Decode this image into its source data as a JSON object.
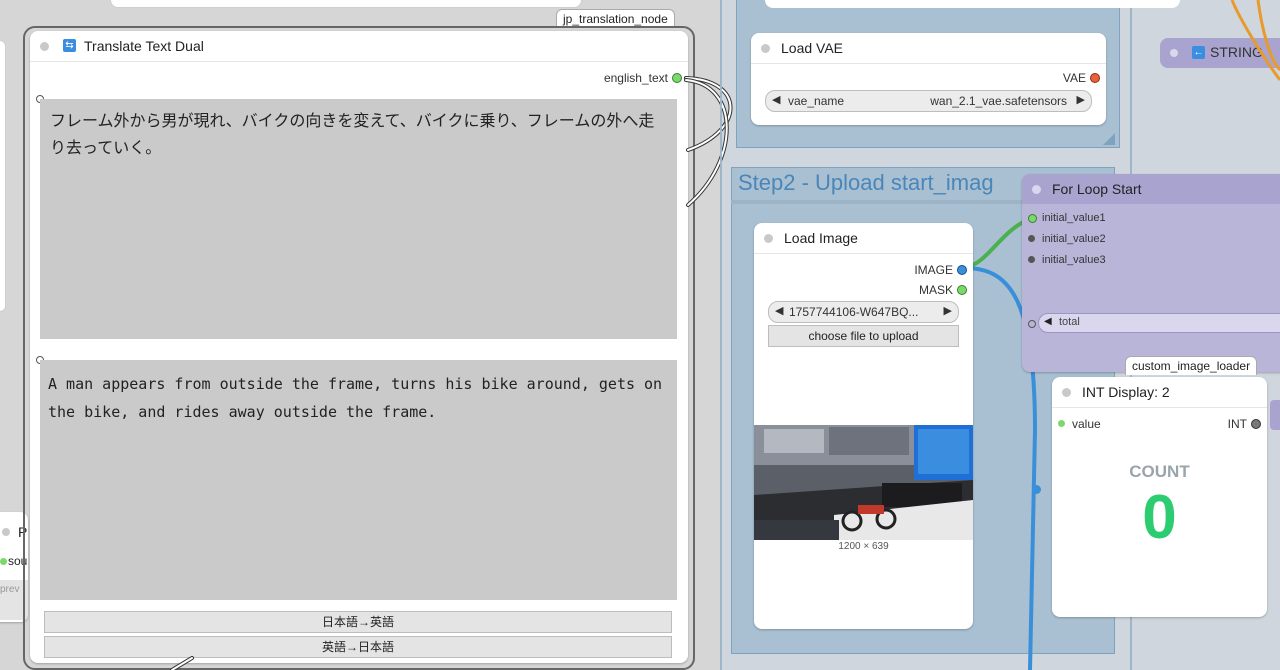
{
  "left_partial_node": {
    "title_fragment": "P",
    "port_label": "sou",
    "preview_fragment": "prev"
  },
  "translate_node": {
    "tag": "jp_translation_node",
    "title": "Translate Text Dual",
    "output_label": "english_text",
    "japanese_text": "フレーム外から男が現れ、バイクの向きを変えて、バイクに乗り、フレームの外へ走り去っていく。",
    "english_text": "A man appears from outside the frame, turns his bike around, gets on the bike, and rides away outside the frame.",
    "button_ja_en": "日本語→英語",
    "button_en_ja": "英語→日本語"
  },
  "load_vae": {
    "title": "Load VAE",
    "output_label": "VAE",
    "widget_name": "vae_name",
    "widget_value": "wan_2.1_vae.safetensors"
  },
  "string_node": {
    "title": "STRING"
  },
  "group_step2": {
    "title": "Step2 - Upload start_imag"
  },
  "load_image": {
    "title": "Load Image",
    "output_image": "IMAGE",
    "output_mask": "MASK",
    "file_value": "1757744106-W647BQ...",
    "upload_button": "choose file to upload",
    "image_size": "1200 × 639"
  },
  "for_loop": {
    "title": "For Loop Start",
    "inputs": [
      "initial_value1",
      "initial_value2",
      "initial_value3"
    ],
    "widget_total": "total"
  },
  "custom_tag": "custom_image_loader",
  "int_display": {
    "title": "INT Display: 2",
    "input_label": "value",
    "output_label": "INT",
    "count_label": "COUNT",
    "count_value": "0"
  },
  "colors": {
    "group_title": "#4a86b8",
    "for_loop_bg": "#b9b5d8",
    "string_bg": "#a9a3cf",
    "count_value": "#2ecc71",
    "image_port": "#3a8fd9",
    "mask_port": "#7bd86b",
    "vae_port": "#e8613a"
  }
}
